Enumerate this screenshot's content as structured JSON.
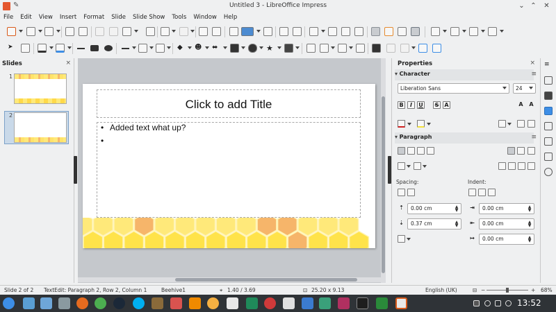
{
  "window": {
    "title": "Untitled 3 - LibreOffice Impress"
  },
  "menu": [
    "File",
    "Edit",
    "View",
    "Insert",
    "Format",
    "Slide",
    "Slide Show",
    "Tools",
    "Window",
    "Help"
  ],
  "slides_pane": {
    "header": "Slides",
    "close": "×",
    "thumbnails": [
      {
        "number": "1"
      },
      {
        "number": "2"
      }
    ]
  },
  "slide": {
    "title_placeholder": "Click to add Title",
    "bullets": [
      "Added text what up?",
      ""
    ],
    "bullet_char": "•",
    "background_colors": {
      "yellow": "#ffe34a",
      "yellow_light": "#ffe97a",
      "orange": "#f6b56a"
    }
  },
  "properties": {
    "header": "Properties",
    "close": "×",
    "character": {
      "header": "Character",
      "font_name": "Liberation Sans",
      "font_size": "24",
      "format_buttons": [
        "B",
        "I",
        "U",
        "S",
        "A"
      ]
    },
    "paragraph": {
      "header": "Paragraph",
      "spacing_label": "Spacing:",
      "indent_label": "Indent:",
      "above_spacing": "0.00 cm",
      "below_spacing": "0.37 cm",
      "before_indent": "0.00 cm",
      "after_indent": "0.00 cm",
      "first_line_indent": "0.00 cm"
    }
  },
  "status": {
    "slide": "Slide 2 of 2",
    "textedit": "TextEdit: Paragraph 2, Row 2, Column 1",
    "master": "Beehive1",
    "position": "1.40 / 3.69",
    "size": "25.20 x 9.13",
    "language": "English (UK)",
    "zoom": "68%"
  },
  "taskbar": {
    "clock": "13:52"
  },
  "colors": {
    "accent": "#3d8ee6",
    "taskbar_bg": "#2f3337"
  }
}
